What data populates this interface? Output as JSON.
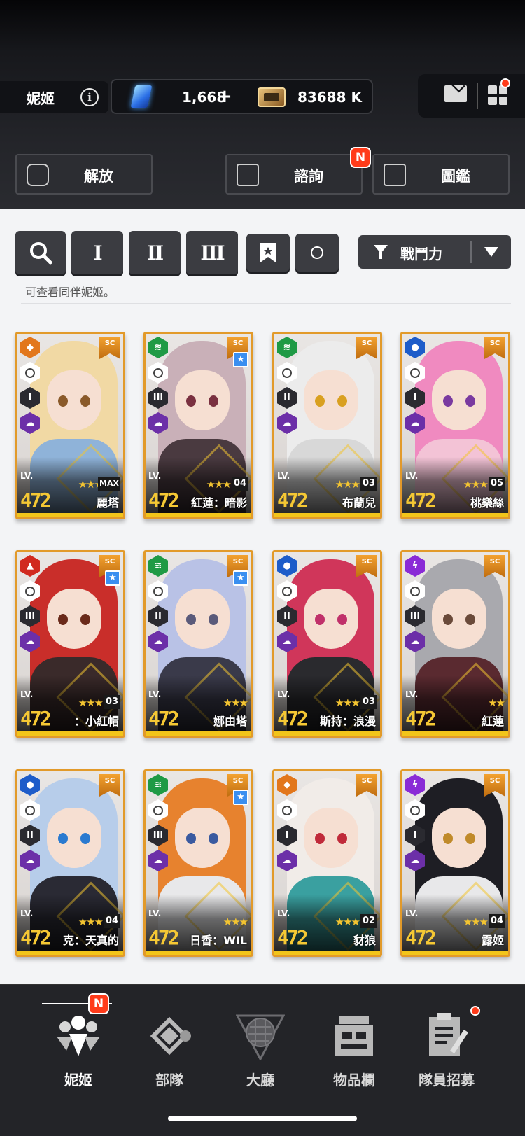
{
  "header": {
    "player_name": "妮姬",
    "gems": "1,668",
    "gems_plus": "+",
    "credits": "83688 K",
    "info_icon": "info-icon",
    "mail_icon": "mail-icon",
    "menu_icon": "grid-menu-icon"
  },
  "actions": {
    "release_label": "解放",
    "consult_label": "諮詢",
    "consult_badge": "N",
    "codex_label": "圖鑑"
  },
  "filters": {
    "search_icon": "search-icon",
    "class_1": "I",
    "class_2": "II",
    "class_3": "III",
    "bookmark_icon": "bookmark-icon",
    "circle_icon": "circle-icon",
    "sort_label": "戰鬥力",
    "hint": "可查看同伴妮姬。"
  },
  "colors": {
    "accent_orange": "#e29a2a",
    "level_yellow": "#f5c834",
    "badge_red": "#ff3b1a",
    "elem_iron": "#e2771c",
    "elem_wind": "#1f9a45",
    "elem_water": "#1d5cc9",
    "elem_fire": "#d12a1f",
    "elem_electric": "#8a2bd6"
  },
  "cards": [
    {
      "name": "麗塔",
      "level": "472",
      "lv": "LV.",
      "rank": "MAX",
      "stars": "★★★",
      "burst": "I",
      "element": "iron",
      "sc": "SC",
      "favorite": false,
      "hair": "#f1d9a4",
      "outfit": "#8fb3d9",
      "eye": "#8a5a2a"
    },
    {
      "name": "紅蓮：暗影",
      "level": "472",
      "lv": "LV.",
      "rank": "04",
      "stars": "★★★",
      "burst": "III",
      "element": "wind",
      "sc": "SC",
      "favorite": true,
      "hair": "#c9b0b8",
      "outfit": "#4a3a40",
      "eye": "#7a3040"
    },
    {
      "name": "布蘭兒",
      "level": "472",
      "lv": "LV.",
      "rank": "03",
      "stars": "★★★",
      "burst": "II",
      "element": "wind",
      "sc": "SC",
      "favorite": false,
      "hair": "#ececec",
      "outfit": "#d8d8d8",
      "eye": "#d9a020"
    },
    {
      "name": "桃樂絲",
      "level": "472",
      "lv": "LV.",
      "rank": "05",
      "stars": "★★★",
      "burst": "I",
      "element": "water",
      "sc": "SC",
      "favorite": false,
      "hair": "#f08ac0",
      "outfit": "#f3c3d6",
      "eye": "#7a3aa0"
    },
    {
      "name": "：小紅帽",
      "level": "472",
      "lv": "LV.",
      "rank": "03",
      "stars": "★★★",
      "burst": "III",
      "element": "fire",
      "sc": "SC",
      "favorite": true,
      "hair": "#c92e2a",
      "outfit": "#3a2a2a",
      "eye": "#6a2a1a"
    },
    {
      "name": "娜由塔",
      "level": "472",
      "lv": "LV.",
      "rank": "",
      "stars": "★★★",
      "burst": "II",
      "element": "wind",
      "sc": "SC",
      "favorite": true,
      "hair": "#b9c2e6",
      "outfit": "#3a3a4a",
      "eye": "#5a5a7a"
    },
    {
      "name": "斯持：浪漫",
      "level": "472",
      "lv": "LV.",
      "rank": "03",
      "stars": "★★★",
      "burst": "II",
      "element": "water",
      "sc": "SC",
      "favorite": false,
      "hair": "#d0365a",
      "outfit": "#2a2a2e",
      "eye": "#c0306a"
    },
    {
      "name": "紅蓮",
      "level": "472",
      "lv": "LV.",
      "rank": "",
      "stars": "★★",
      "burst": "III",
      "element": "electric",
      "sc": "SC",
      "favorite": false,
      "hair": "#a9a9ae",
      "outfit": "#5a2a30",
      "eye": "#6a4a3a"
    },
    {
      "name": "克：天真的",
      "level": "472",
      "lv": "LV.",
      "rank": "04",
      "stars": "★★★",
      "burst": "II",
      "element": "water",
      "sc": "SC",
      "favorite": false,
      "hair": "#b7cdea",
      "outfit": "#2a2a34",
      "eye": "#2a7ad0"
    },
    {
      "name": "日香：WIL",
      "level": "472",
      "lv": "LV.",
      "rank": "",
      "stars": "★★★",
      "burst": "III",
      "element": "wind",
      "sc": "SC",
      "favorite": true,
      "hair": "#e7822e",
      "outfit": "#e8e8ea",
      "eye": "#3a5aa0"
    },
    {
      "name": "豺狼",
      "level": "472",
      "lv": "LV.",
      "rank": "02",
      "stars": "★★★",
      "burst": "I",
      "element": "iron",
      "sc": "SC",
      "favorite": false,
      "hair": "#f1ece8",
      "outfit": "#3aa0a0",
      "eye": "#c02a3a"
    },
    {
      "name": "露姬",
      "level": "472",
      "lv": "LV.",
      "rank": "04",
      "stars": "★★★",
      "burst": "I",
      "element": "electric",
      "sc": "SC",
      "favorite": false,
      "hair": "#1e1e24",
      "outfit": "#e8e8ea",
      "eye": "#c08a2a"
    }
  ],
  "nav": {
    "nikke": "妮姬",
    "squad": "部隊",
    "lobby": "大廳",
    "inventory": "物品欄",
    "recruit": "隊員招募",
    "nikke_badge": "N"
  }
}
